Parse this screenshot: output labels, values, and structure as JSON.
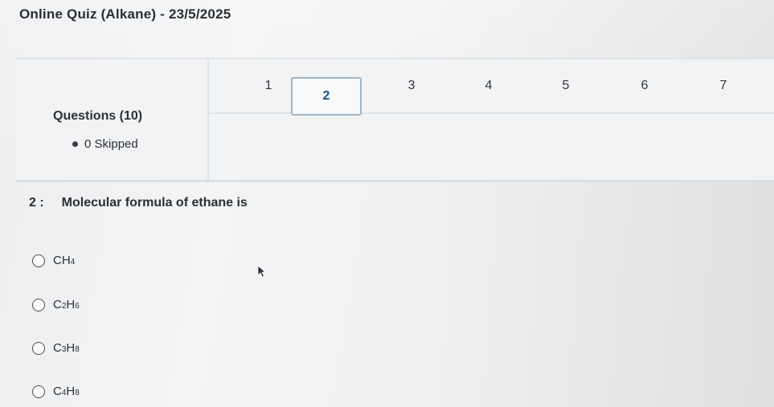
{
  "quiz": {
    "title": "Online Quiz (Alkane) - 23/5/2025"
  },
  "navigator": {
    "questions_heading": "Questions (10)",
    "skipped_label": "0 Skipped",
    "numbers": [
      "1",
      "2",
      "3",
      "4",
      "5",
      "6",
      "7"
    ],
    "active_number": "2"
  },
  "question": {
    "number": "2 :",
    "text": "Molecular formula of ethane is",
    "options": [
      {
        "c": "C",
        "h": "H",
        "c_sub": "",
        "h_sub": "4",
        "full": "CH4"
      },
      {
        "c": "C",
        "h": "H",
        "c_sub": "2",
        "h_sub": "6",
        "full": "C2H6"
      },
      {
        "c": "C",
        "h": "H",
        "c_sub": "3",
        "h_sub": "8",
        "full": "C3H8"
      },
      {
        "c": "C",
        "h": "H",
        "c_sub": "4",
        "h_sub": "8",
        "full": "C4H8"
      }
    ]
  },
  "colors": {
    "active_border": "#9fb5c8",
    "active_text": "#1e4f8a",
    "text": "#2b2f33"
  }
}
